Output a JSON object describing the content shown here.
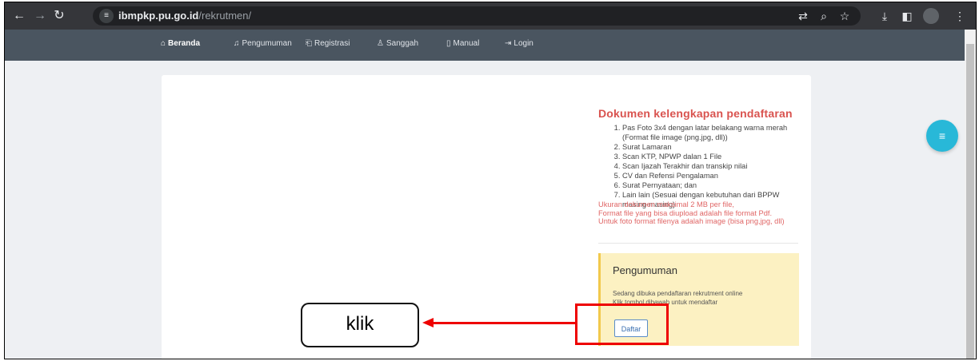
{
  "browser": {
    "url_domain": "ibmpkp.pu.go.id",
    "url_path": "/rekrutmen/",
    "icons": [
      "back-icon",
      "forward-icon",
      "reload-icon",
      "site-settings-icon",
      "translate-icon",
      "zoom-icon",
      "bookmark-star-icon",
      "download-icon",
      "sidepanel-icon",
      "profile-icon",
      "menu-icon"
    ]
  },
  "nav": {
    "items": [
      {
        "label": "Beranda",
        "icon": "⌂"
      },
      {
        "label": "Pengumuman",
        "icon": "♫"
      },
      {
        "label": "Registrasi",
        "icon": "⎗"
      },
      {
        "label": "Sanggah",
        "icon": "♙"
      },
      {
        "label": "Manual",
        "icon": "▯"
      },
      {
        "label": "Login",
        "icon": "⇥"
      }
    ]
  },
  "docs": {
    "title": "Dokumen kelengkapan pendaftaran",
    "items": [
      "Pas Foto 3x4 dengan latar belakang warna merah (Format file image (png.jpg, dll))",
      "Surat Lamaran",
      "Scan KTP, NPWP dalan 1 File",
      "Scan Ijazah Terakhir dan transkip nilai",
      "CV dan Refensi Pengalaman",
      "Surat Pernyataan; dan",
      "Lain lain (Sesuai dengan kebutuhan dari BPPW masing-masing)"
    ],
    "notes": [
      "Ukuran dokumen maksimal 2 MB per file,",
      "Format file yang bisa diupload adalah file format Pdf.",
      "Untuk foto format filenya adalah image (bisa png,jpg, dll)"
    ]
  },
  "announcement": {
    "title": "Pengumuman",
    "line1": "Sedang dibuka pendaftaran rekrutment online",
    "line2": "Klik tombol dibawah untuk mendaftar",
    "button": "Daftar"
  },
  "callout": {
    "label": "klik"
  },
  "colors": {
    "nav_bg": "#4a5560",
    "docs_title": "#d9534f",
    "announce_bg": "#fcf1c2",
    "fab": "#28b8d8",
    "annotation_red": "#e00000"
  }
}
